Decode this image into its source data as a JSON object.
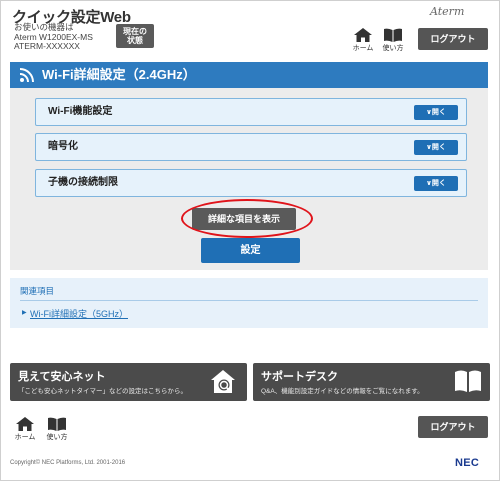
{
  "header": {
    "app_title": "クイック設定Web",
    "device_caption": "お使いの機器は",
    "device_model": "Aterm W1200EX-MS",
    "device_id": "ATERM-XXXXXX",
    "status_button_line1": "現在の",
    "status_button_line2": "状態",
    "brand_logo": "Aterm",
    "home_label": "ホーム",
    "manual_label": "使い方",
    "logout_label": "ログアウト"
  },
  "panel": {
    "title": "Wi-Fi詳細設定（2.4GHz）",
    "sections": [
      {
        "label": "Wi-Fi機能設定",
        "open_label": "開く"
      },
      {
        "label": "暗号化",
        "open_label": "開く"
      },
      {
        "label": "子機の接続制限",
        "open_label": "開く"
      }
    ],
    "detail_button_label": "詳細な項目を表示",
    "setting_button_label": "設定"
  },
  "related": {
    "heading": "関連項目",
    "link_label": "Wi-Fi詳細設定（5GHz）"
  },
  "banners": [
    {
      "title": "見えて安心ネット",
      "description": "「こども安心ネットタイマー」などの設定はこちらから。",
      "icon": "house-search-icon"
    },
    {
      "title": "サポートデスク",
      "description": "Q&A、機能別設定ガイドなどの情報をご覧になれます。",
      "icon": "open-book-icon"
    }
  ],
  "footer": {
    "home_label": "ホーム",
    "manual_label": "使い方",
    "logout_label": "ログアウト",
    "copyright": "Copyright© NEC Platforms, Ltd. 2001-2016",
    "nec_logo": "NEC"
  },
  "colors": {
    "accent_blue": "#1f6fb5",
    "title_blue": "#2e7bbf",
    "dark_button": "#555555",
    "highlight_red": "#e0141b"
  }
}
